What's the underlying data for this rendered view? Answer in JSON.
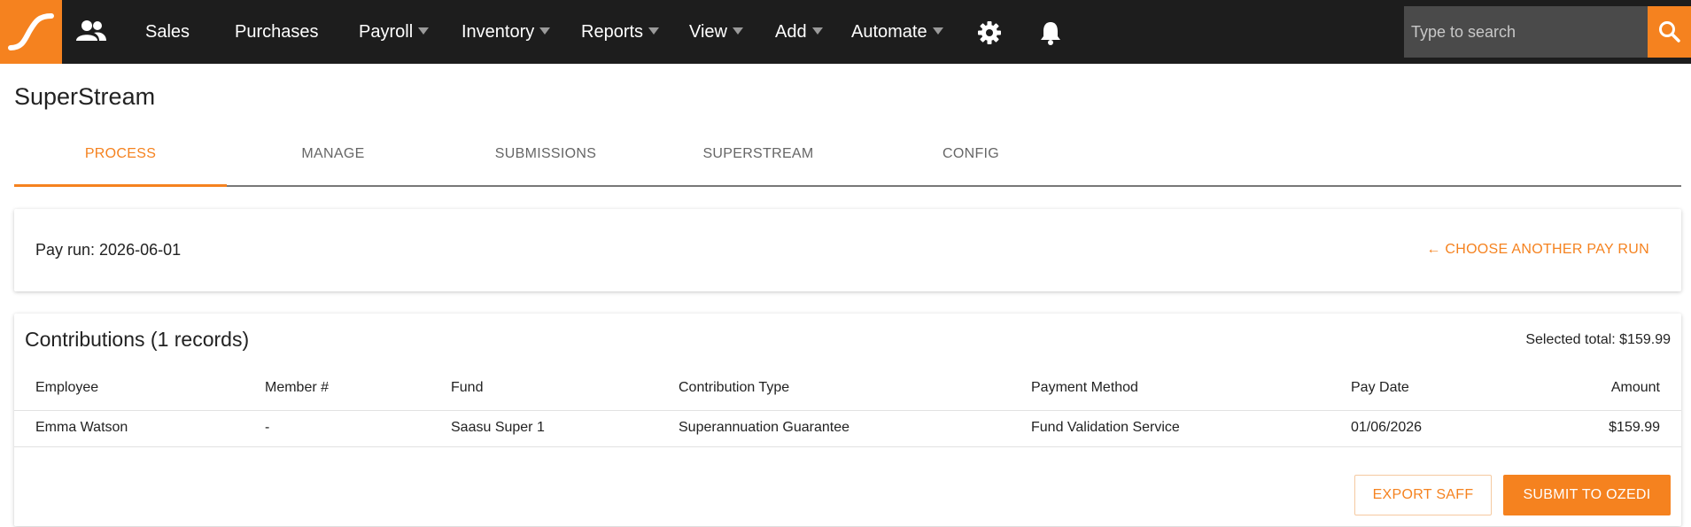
{
  "nav": {
    "logo_icon": "saasu-swoosh-icon",
    "people_icon": "people-icon",
    "items": [
      {
        "label": "Sales"
      },
      {
        "label": "Purchases"
      },
      {
        "label": "Payroll"
      },
      {
        "label": "Inventory"
      },
      {
        "label": "Reports"
      },
      {
        "label": "View"
      },
      {
        "label": "Add"
      },
      {
        "label": "Automate"
      }
    ],
    "settings_icon": "gear-icon",
    "notifications_icon": "bell-icon",
    "search_placeholder": "Type to search",
    "search_icon": "search-icon"
  },
  "page": {
    "title": "SuperStream"
  },
  "tabs": [
    {
      "label": "PROCESS",
      "active": true
    },
    {
      "label": "MANAGE"
    },
    {
      "label": "SUBMISSIONS"
    },
    {
      "label": "SUPERSTREAM"
    },
    {
      "label": "CONFIG"
    }
  ],
  "payrun": {
    "label": "Pay run: 2026-06-01",
    "choose_label": "← CHOOSE ANOTHER PAY RUN"
  },
  "contributions": {
    "title": "Contributions (1 records)",
    "selected_total": "Selected total: $159.99",
    "columns": [
      "Employee",
      "Member #",
      "Fund",
      "Contribution Type",
      "Payment Method",
      "Pay Date",
      "Amount"
    ],
    "rows": [
      [
        "Emma Watson",
        "-",
        "Saasu Super 1",
        "Superannuation Guarantee",
        "Fund Validation Service",
        "01/06/2026",
        "$159.99"
      ]
    ],
    "export_label": "EXPORT SAFF",
    "submit_label": "SUBMIT TO OZEDI"
  },
  "colors": {
    "accent": "#f5821f",
    "nav_bg": "#1d1d1d"
  }
}
